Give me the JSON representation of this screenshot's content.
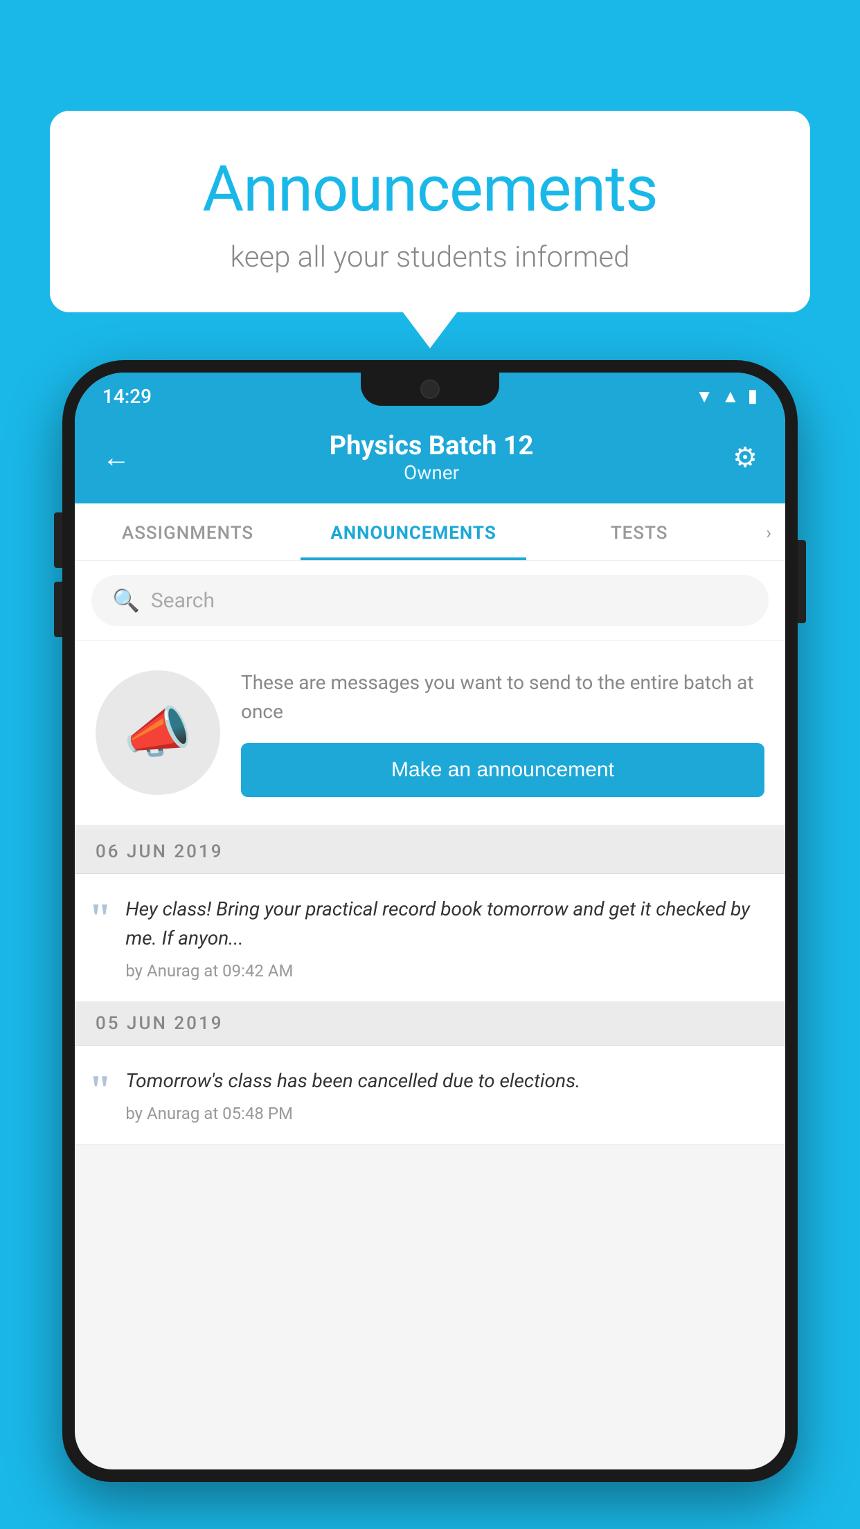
{
  "background_color": "#1ab8e8",
  "speech_bubble": {
    "title": "Announcements",
    "subtitle": "keep all your students informed"
  },
  "phone": {
    "status_bar": {
      "time": "14:29",
      "icons": [
        "wifi",
        "signal",
        "battery"
      ]
    },
    "header": {
      "title": "Physics Batch 12",
      "subtitle": "Owner",
      "back_label": "←",
      "gear_label": "⚙"
    },
    "tabs": [
      {
        "label": "ASSIGNMENTS",
        "active": false
      },
      {
        "label": "ANNOUNCEMENTS",
        "active": true
      },
      {
        "label": "TESTS",
        "active": false
      }
    ],
    "search": {
      "placeholder": "Search"
    },
    "promo": {
      "description": "These are messages you want to send to the entire batch at once",
      "button_label": "Make an announcement"
    },
    "announcements": [
      {
        "date": "06  JUN  2019",
        "text": "Hey class! Bring your practical record book tomorrow and get it checked by me. If anyon...",
        "meta": "by Anurag at 09:42 AM"
      },
      {
        "date": "05  JUN  2019",
        "text": "Tomorrow's class has been cancelled due to elections.",
        "meta": "by Anurag at 05:48 PM"
      }
    ]
  }
}
